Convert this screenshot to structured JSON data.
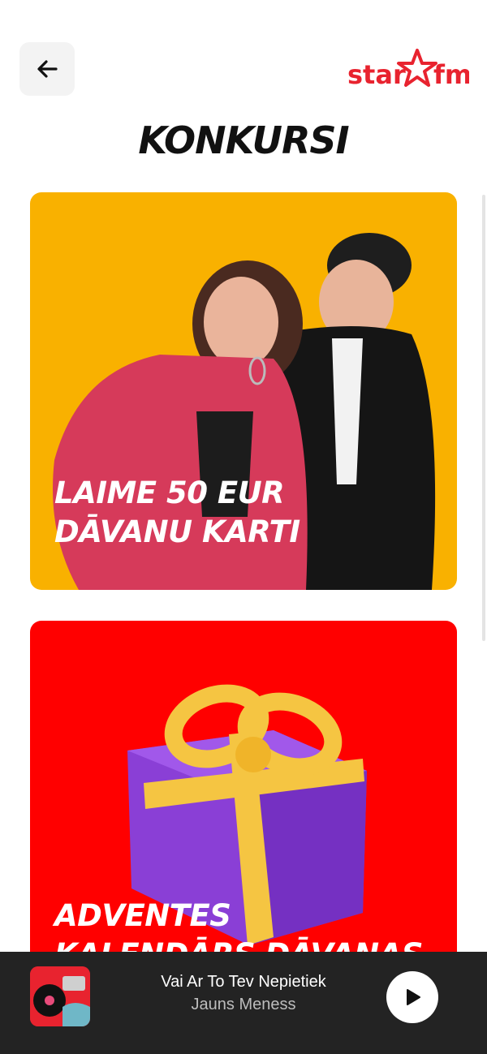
{
  "header": {
    "back_icon": "arrow-left-icon",
    "logo_text_left": "star",
    "logo_text_right": "fm",
    "title": "KONKURSI"
  },
  "contests": [
    {
      "caption": "LAIME 50 EUR DĀVANU KARTI",
      "color": "#f9b100"
    },
    {
      "caption": "ADVENTES KALENDĀRS DĀVANAS",
      "color": "#ff0000"
    }
  ],
  "player": {
    "title": "Vai Ar To Tev Nepietiek",
    "artist": "Jauns Meness",
    "play_icon": "play-icon"
  },
  "colors": {
    "brand": "#e8232f",
    "player_bg": "#232323"
  }
}
